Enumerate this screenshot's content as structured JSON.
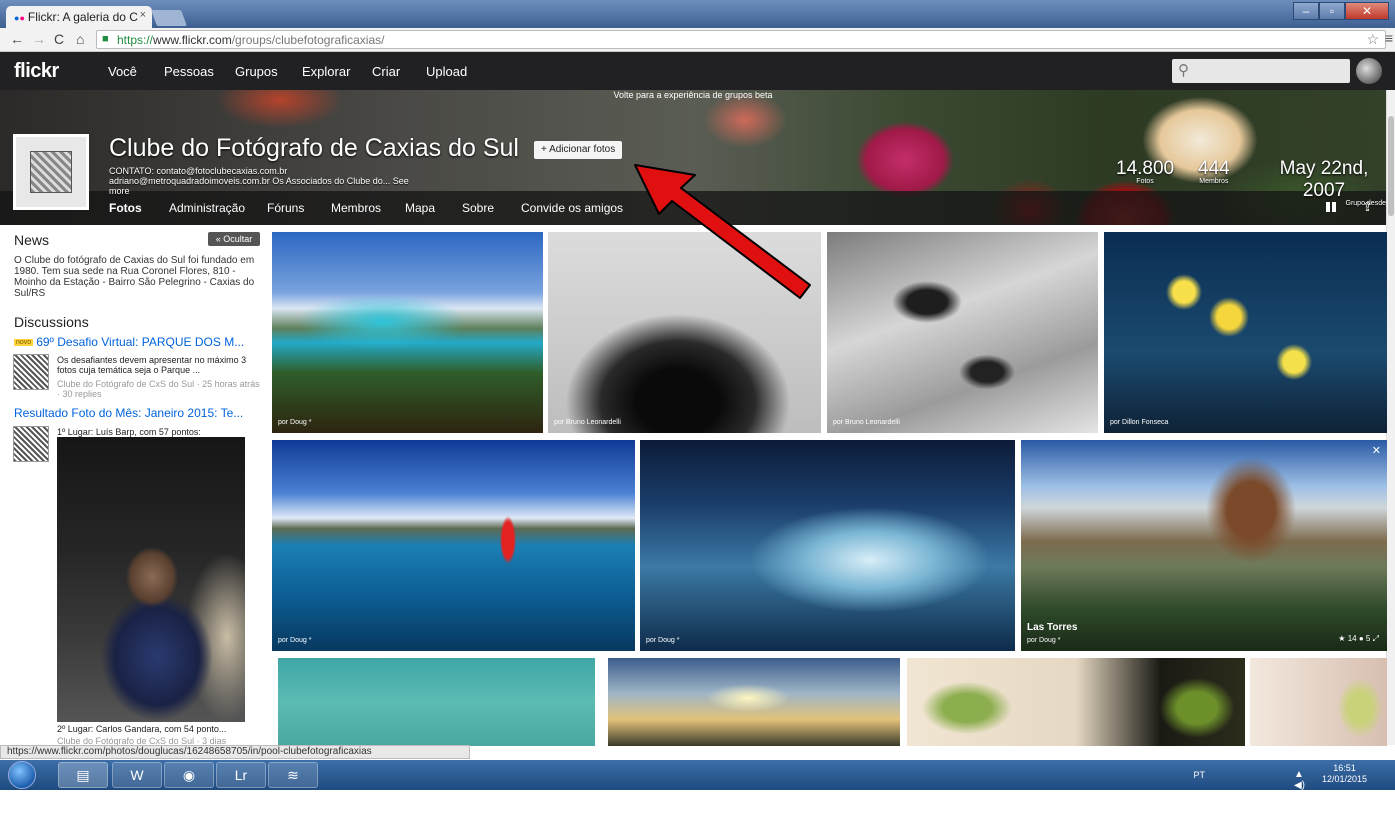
{
  "browser": {
    "tab_title": "Flickr: A galeria do C",
    "url_https": "https://",
    "url_host": "www.flickr.com",
    "url_path": "/groups/clubefotograficaxias/",
    "status_url": "https://www.flickr.com/photos/douglucas/16248658705/in/pool-clubefotograficaxias"
  },
  "flickr_nav": {
    "logo": "flickr",
    "items": [
      "Você",
      "Pessoas",
      "Grupos",
      "Explorar",
      "Criar",
      "Upload"
    ]
  },
  "group": {
    "beta_banner": "Volte para a experiência de grupos beta",
    "name": "Clube do Fotógrafo de Caxias do Sul",
    "add_photos": "+ Adicionar fotos",
    "desc_line1": "CONTATO: contato@fotoclubecaxias.com.br",
    "desc_line2": "adriano@metroquadradoimoveis.com.br Os Associados do Clube do... See",
    "desc_line3": "more",
    "stats": [
      {
        "value": "14.800",
        "label": "Fotos"
      },
      {
        "value": "444",
        "label": "Membros"
      },
      {
        "value": "May 22nd, 2007",
        "label": "Grupo desde"
      }
    ],
    "tabs": [
      "Fotos",
      "Administração",
      "Fóruns",
      "Membros",
      "Mapa",
      "Sobre",
      "Convide os amigos"
    ]
  },
  "sidebar": {
    "news_heading": "News",
    "hide_button": "« Ocultar",
    "news_text": "O Clube do fotógrafo de Caxias do Sul foi fundado em 1980. Tem sua sede na Rua Coronel Flores, 810 - Moinho da Estação - Bairro São Pelegrino - Caxias do Sul/RS",
    "discussions_heading": "Discussions",
    "novo_badge": "novo",
    "disc1_title": "69º Desafio Virtual: PARQUE DOS M...",
    "disc1_body": "Os desafiantes devem apresentar no máximo 3 fotos cuja temática seja o Parque ...",
    "disc1_meta": "Clube do Fotógrafo de CxS do Sul · 25 horas atrás · 30 replies",
    "disc2_title": "Resultado Foto do Mês: Janeiro 2015: Te...",
    "disc2_body": "1º Lugar: Luís Barp, com 57 pontos:",
    "disc2_second": "2º Lugar: Carlos Gandara, com 54 ponto...",
    "disc2_meta": "Clube do Fotógrafo de CxS do Sul · 3 dias"
  },
  "photos": [
    {
      "caption": "por Doug *"
    },
    {
      "caption": "por Bruno Leonardelli"
    },
    {
      "caption": "por Bruno Leonardelli"
    },
    {
      "caption": "por Dillon Fonseca"
    },
    {
      "caption": "por Doug *"
    },
    {
      "caption": "por Doug *"
    },
    {
      "title": "Las Torres",
      "caption": "por Doug *",
      "faves": "14",
      "comments": "5"
    }
  ],
  "taskbar": {
    "apps": [
      "Windows Explorer",
      "Word",
      "Chrome",
      "Lr",
      "Spotify"
    ],
    "lr_label": "Lr",
    "lang": "PT",
    "time": "16:51",
    "date": "12/01/2015"
  },
  "colors": {
    "flickr_blue": "#0063dc",
    "flickr_pink": "#ff0084",
    "header_bg": "#212124",
    "arrow_red": "#e01010"
  }
}
